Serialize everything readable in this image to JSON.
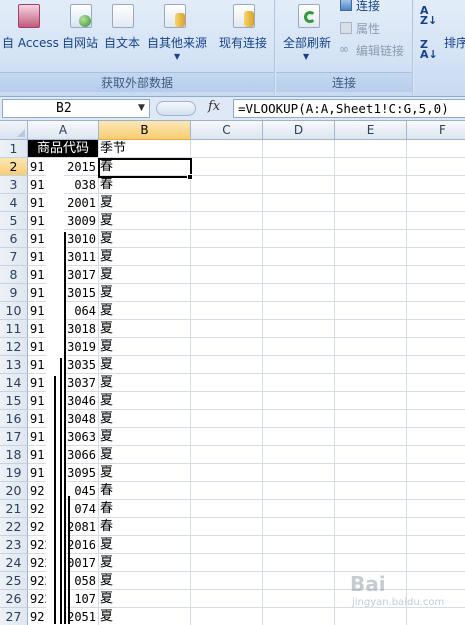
{
  "ribbon": {
    "groups": [
      {
        "title": "获取外部数据"
      },
      {
        "title": "连接"
      }
    ],
    "buttons": {
      "access": "自 Access",
      "web": "自网站",
      "text": "自文本",
      "other_sources": "自其他来源",
      "existing_connections": "现有连接",
      "refresh_all": "全部刷新",
      "connections": "连接",
      "properties": "属性",
      "edit_links": "编辑链接",
      "sort": "排序"
    }
  },
  "formula_bar": {
    "name_box": "B2",
    "fx": "fx",
    "formula": "=VLOOKUP(A:A,Sheet1!C:G,5,0)"
  },
  "sheet": {
    "columns": [
      "A",
      "B",
      "C",
      "D",
      "E",
      "F"
    ],
    "selected_column": "B",
    "selected_row": 2,
    "header_row": {
      "a": "商品代码",
      "b": "季节"
    },
    "rows": [
      {
        "n": "1"
      },
      {
        "n": "2",
        "a": "91",
        "a2": "2015",
        "b": "春"
      },
      {
        "n": "3",
        "a": "91",
        "a2": "038",
        "b": "春"
      },
      {
        "n": "4",
        "a": "91",
        "a2": "2001",
        "b": "夏"
      },
      {
        "n": "5",
        "a": "91",
        "a2": "3009",
        "b": "夏"
      },
      {
        "n": "6",
        "a": "91",
        "a2": "3010",
        "b": "夏"
      },
      {
        "n": "7",
        "a": "91",
        "a2": "3011",
        "b": "夏"
      },
      {
        "n": "8",
        "a": "91",
        "a2": "3017",
        "b": "夏"
      },
      {
        "n": "9",
        "a": "91",
        "a2": "3015",
        "b": "夏"
      },
      {
        "n": "10",
        "a": "91",
        "a2": "064",
        "b": "夏"
      },
      {
        "n": "11",
        "a": "91",
        "a2": "3018",
        "b": "夏"
      },
      {
        "n": "12",
        "a": "91",
        "a2": "3019",
        "b": "夏"
      },
      {
        "n": "13",
        "a": "91",
        "a2": "3035",
        "b": "夏"
      },
      {
        "n": "14",
        "a": "91",
        "a2": "3037",
        "b": "夏"
      },
      {
        "n": "15",
        "a": "91",
        "a2": "3046",
        "b": "夏"
      },
      {
        "n": "16",
        "a": "91",
        "a2": "3048",
        "b": "夏"
      },
      {
        "n": "17",
        "a": "91",
        "a2": "3063",
        "b": "夏"
      },
      {
        "n": "18",
        "a": "91",
        "a2": "3066",
        "b": "夏"
      },
      {
        "n": "19",
        "a": "91",
        "a2": "3095",
        "b": "夏"
      },
      {
        "n": "20",
        "a": "921",
        "a2": "045",
        "b": "春"
      },
      {
        "n": "21",
        "a": "921",
        "a2": "074",
        "b": "春"
      },
      {
        "n": "22",
        "a": "921",
        "a2": "2081",
        "b": "春"
      },
      {
        "n": "23",
        "a": "922",
        "a2": "2016",
        "b": "夏"
      },
      {
        "n": "24",
        "a": "922",
        "a2": "0017",
        "b": "夏"
      },
      {
        "n": "25",
        "a": "922",
        "a2": "058",
        "b": "夏"
      },
      {
        "n": "26",
        "a": "922",
        "a2": "107",
        "b": "夏"
      },
      {
        "n": "27",
        "a": "92",
        "a2": "2051",
        "b": "夏"
      }
    ]
  },
  "watermark": {
    "text": "Bai",
    "sub": "jingyan.baidu.com"
  },
  "colors": {
    "selection_header": "#f8cd73",
    "ribbon_text": "#15428b"
  }
}
